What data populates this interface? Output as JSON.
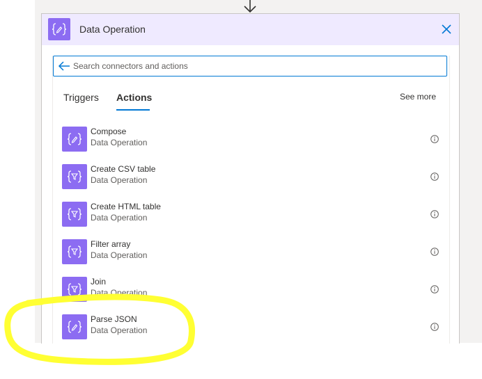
{
  "header": {
    "title": "Data Operation",
    "icon": "curly-braces-pencil-icon",
    "accent": "#8c6cf2",
    "header_bg": "#efeaff"
  },
  "search": {
    "placeholder": "Search connectors and actions",
    "value": ""
  },
  "tabs": [
    {
      "label": "Triggers",
      "active": false
    },
    {
      "label": "Actions",
      "active": true
    }
  ],
  "see_more": "See more",
  "actions": [
    {
      "title": "Compose",
      "subtitle": "Data Operation",
      "icon": "curly-braces-pencil-icon"
    },
    {
      "title": "Create CSV table",
      "subtitle": "Data Operation",
      "icon": "curly-braces-filter-icon"
    },
    {
      "title": "Create HTML table",
      "subtitle": "Data Operation",
      "icon": "curly-braces-filter-icon"
    },
    {
      "title": "Filter array",
      "subtitle": "Data Operation",
      "icon": "curly-braces-filter-icon"
    },
    {
      "title": "Join",
      "subtitle": "Data Operation",
      "icon": "curly-braces-filter-icon"
    },
    {
      "title": "Parse JSON",
      "subtitle": "Data Operation",
      "icon": "curly-braces-pencil-icon"
    }
  ],
  "colors": {
    "focus_blue": "#0078d4",
    "highlight_yellow": "#ffff33"
  }
}
